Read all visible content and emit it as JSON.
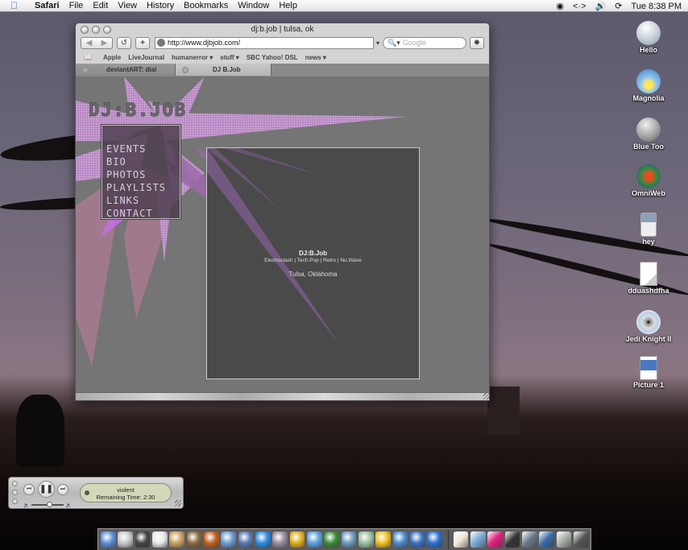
{
  "menubar": {
    "app_name": "Safari",
    "items": [
      "File",
      "Edit",
      "View",
      "History",
      "Bookmarks",
      "Window",
      "Help"
    ],
    "clock": "Tue 8:38 PM",
    "status_icons": [
      "ichat-icon",
      "network-icon",
      "volume-icon",
      "sync-icon"
    ]
  },
  "browser": {
    "window_title": "dj:b.job | tulsa, ok",
    "url": "http://www.djbjob.com/",
    "search_placeholder": "Google",
    "bookmarks": [
      "Apple",
      "LiveJournal",
      "humanerror ▾",
      "stuff ▾",
      "SBC Yahoo! DSL",
      "news ▾"
    ],
    "tabs": [
      {
        "label": "deviantART: dial",
        "active": false
      },
      {
        "label": "DJ B.Job",
        "active": true
      }
    ]
  },
  "page": {
    "logo": "DJ:B.JOB",
    "nav": [
      "EVENTS",
      "BIO",
      "PHOTOS",
      "PLAYLISTS",
      "LINKS",
      "CONTACT"
    ],
    "dj_name": "DJ:B.Job",
    "genres": "Electroclash | Tech.Pop | Retro | Nu.Wave",
    "location": "Tulsa, Oklahoma",
    "colors": {
      "accent_pink": "#c48ad0",
      "page_bg": "#757575",
      "content_bg": "#4a4a4a"
    }
  },
  "desktop_icons": [
    {
      "label": "Hello",
      "icon": "hard-drive-icon"
    },
    {
      "label": "Magnolia",
      "icon": "hard-drive-icon"
    },
    {
      "label": "Blue Too",
      "icon": "hard-drive-icon"
    },
    {
      "label": "OmniWeb",
      "icon": "omniweb-icon"
    },
    {
      "label": "hey",
      "icon": "ipod-icon"
    },
    {
      "label": "dduashdfha",
      "icon": "document-icon"
    },
    {
      "label": "Jedi Knight II",
      "icon": "cd-icon"
    },
    {
      "label": "Picture 1",
      "icon": "pdf-icon"
    }
  ],
  "itunes": {
    "track": "violent",
    "remaining": "Remaining Time: 2:30",
    "volume": 0.55
  },
  "dock": {
    "apps": [
      "Finder",
      "System Preferences",
      "Sherlock",
      "iCal",
      "Address Book",
      "Dictionary",
      "iPhoto",
      "Preview",
      "Mail",
      "QuickTime Player",
      "Game",
      "Transmit",
      "Safari",
      "OmniWeb",
      "Camino",
      "iTunes",
      "AIM",
      "iChat",
      "Adium",
      "Internet Explorer"
    ],
    "running": [
      "Finder",
      "Preview",
      "Mail",
      "Safari",
      "iTunes",
      "iChat",
      "Adium",
      "Internet Explorer"
    ],
    "docs": [
      "Home",
      "Applications",
      "Favorites",
      "Terminal",
      "Network",
      "Text",
      "Disk",
      "Trash"
    ]
  }
}
